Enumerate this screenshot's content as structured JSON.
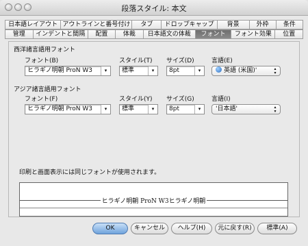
{
  "window": {
    "title": "段落スタイル: 本文"
  },
  "tabs_row1": [
    "日本語レイアウト",
    "アウトラインと番号付け",
    "タブ",
    "ドロップキャップ",
    "背景",
    "外枠",
    "条件"
  ],
  "tabs_row2": [
    "管理",
    "インデントと間隔",
    "配置",
    "体裁",
    "日本語文の体裁",
    "フォント",
    "フォント効果",
    "位置"
  ],
  "active_tab": "フォント",
  "western": {
    "heading": "西洋諸言語用フォント",
    "font_label": "フォント(B)",
    "font_value": "ヒラギノ明朝 ProN W3",
    "style_label": "スタイル(T)",
    "style_value": "標準",
    "size_label": "サイズ(D)",
    "size_value": "8pt",
    "lang_label": "言語(E)",
    "lang_value": "英語 (米国)'"
  },
  "asian": {
    "heading": "アジア諸言語用フォント",
    "font_label": "フォント(F)",
    "font_value": "ヒラギノ明朝 ProN W3",
    "style_label": "スタイル(Y)",
    "style_value": "標準",
    "size_label": "サイズ(G)",
    "size_value": "8pt",
    "lang_label": "言語(I)",
    "lang_value": "'日本語'"
  },
  "info_text": "印刷と画面表示には同じフォントが使用されます。",
  "preview_text": "ヒラギノ明朝 ProN W3ヒラギノ明朝",
  "buttons": {
    "ok": "OK",
    "cancel": "キャンセル",
    "help": "ヘルプ(H)",
    "reset": "元に戻す(R)",
    "standard": "標準(A)"
  },
  "icons": {
    "arrow_down": "▾",
    "arrow_updown": "▴▾"
  }
}
